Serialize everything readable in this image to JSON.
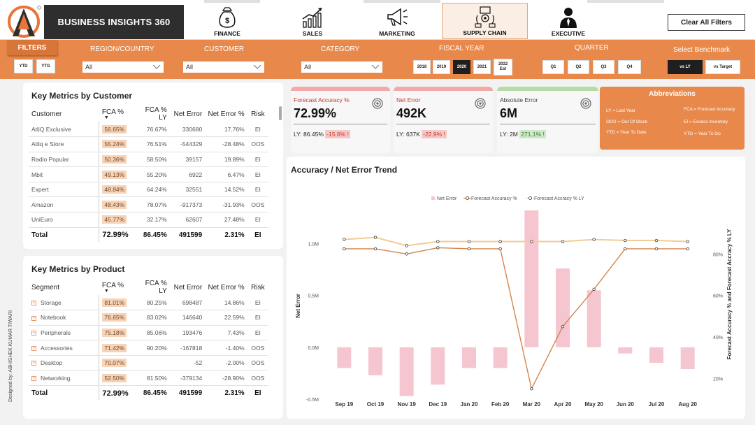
{
  "brand": {
    "title": "BUSINESS INSIGHTS 360"
  },
  "nav": {
    "tabs": [
      {
        "label": "FINANCE",
        "icon": "money-bag-icon"
      },
      {
        "label": "SALES",
        "icon": "sales-growth-icon"
      },
      {
        "label": "MARKETING",
        "icon": "megaphone-icon"
      },
      {
        "label": "SUPPLY CHAIN",
        "icon": "supply-chain-icon",
        "active": true
      },
      {
        "label": "EXECUTIVE",
        "icon": "executive-icon"
      }
    ],
    "clear_filters": "Clear All Filters"
  },
  "filters": {
    "tab_label": "FILTERS",
    "ytd": "YTD",
    "ytg": "YTG",
    "region_label": "REGION/COUNTRY",
    "customer_label": "CUSTOMER",
    "category_label": "CATEGORY",
    "fiscal_year_label": "FISCAL YEAR",
    "quarter_label": "QUARTER",
    "benchmark_label": "Select Benchmark",
    "region_value": "All",
    "customer_value": "All",
    "category_value": "All",
    "years": [
      "2018",
      "2019",
      "2020",
      "2021",
      "2022 Est"
    ],
    "selected_year": "2020",
    "quarters": [
      "Q1",
      "Q2",
      "Q3",
      "Q4"
    ],
    "benchmarks": [
      "vs LY",
      "vs Target"
    ],
    "selected_benchmark": "vs LY"
  },
  "customer_table": {
    "title": "Key Metrics by Customer",
    "headers": [
      "Customer",
      "FCA %",
      "FCA % LY",
      "Net Error",
      "Net Error %",
      "Risk"
    ],
    "rows": [
      [
        "AtliQ Exclusive",
        "56.65%",
        "76.67%",
        "330680",
        "17.76%",
        "EI"
      ],
      [
        "Atliq e Store",
        "55.24%",
        "76.51%",
        "-544329",
        "-28.48%",
        "OOS"
      ],
      [
        "Radio Popular",
        "50.36%",
        "58.50%",
        "39157",
        "19.89%",
        "EI"
      ],
      [
        "Mbit",
        "49.13%",
        "55.20%",
        "6922",
        "6.47%",
        "EI"
      ],
      [
        "Expert",
        "48.84%",
        "64.24%",
        "32551",
        "14.52%",
        "EI"
      ],
      [
        "Amazon",
        "48.43%",
        "78.07%",
        "-917373",
        "-31.93%",
        "OOS"
      ],
      [
        "UniEuro",
        "45.77%",
        "32.17%",
        "62607",
        "27.48%",
        "EI"
      ]
    ],
    "total": [
      "Total",
      "72.99%",
      "86.45%",
      "491599",
      "2.31%",
      "EI"
    ]
  },
  "product_table": {
    "title": "Key Metrics by Product",
    "headers": [
      "Segment",
      "FCA %",
      "FCA % LY",
      "Net Error",
      "Net Error %",
      "Risk"
    ],
    "rows": [
      [
        "Storage",
        "81.01%",
        "80.25%",
        "698487",
        "14.86%",
        "EI"
      ],
      [
        "Notebook",
        "76.65%",
        "83.02%",
        "146640",
        "22.59%",
        "EI"
      ],
      [
        "Peripherals",
        "75.18%",
        "85.06%",
        "193476",
        "7.43%",
        "EI"
      ],
      [
        "Accessories",
        "71.42%",
        "90.20%",
        "-167818",
        "-1.40%",
        "OOS"
      ],
      [
        "Desktop",
        "70.07%",
        "",
        "-52",
        "-2.00%",
        "OOS"
      ],
      [
        "Networking",
        "52.50%",
        "81.50%",
        "-379134",
        "-28.90%",
        "OOS"
      ]
    ],
    "total": [
      "Total",
      "72.99%",
      "86.45%",
      "491599",
      "2.31%",
      "EI"
    ]
  },
  "kpis": [
    {
      "label": "Forecast Accuracy %",
      "value": "72.99%",
      "ly_label": "LY:",
      "ly_value": "86.45%",
      "change": "-15.6%",
      "change_icon": "!",
      "trend": "neg",
      "top_color": "#f4a9a9"
    },
    {
      "label": "Net Error",
      "value": "492K",
      "ly_label": "LY:",
      "ly_value": "637K",
      "change": "-22.9%",
      "change_icon": "!",
      "trend": "neg",
      "top_color": "#f4a9a9"
    },
    {
      "label": "Absolute Error",
      "value": "6M",
      "ly_label": "LY:",
      "ly_value": "2M",
      "change": "271.1%",
      "change_icon": "!",
      "trend": "pos",
      "top_color": "#b5dca8"
    }
  ],
  "abbreviations": {
    "title": "Abbreviations",
    "items": [
      "LY = Last Year",
      "FCA = Forecast Accuracy",
      "OOS = Out Of Stock",
      "EI = Excess Inventory",
      "YTD = Year To Date",
      "YTG = Year To Go"
    ]
  },
  "credit": "Designed by: ABHISHEK KUMAR TIWARI",
  "chart_data": {
    "type": "bar",
    "title": "Accuracy / Net Error Trend",
    "categories": [
      "Sep 19",
      "Oct 19",
      "Nov 19",
      "Dec 19",
      "Jan 20",
      "Feb 20",
      "Mar 20",
      "Apr 20",
      "May 20",
      "Jun 20",
      "Jul 20",
      "Aug 20"
    ],
    "ylabel": "Net Error",
    "y2label": "Forecast Accuracy % and Forecast Accracy % LY",
    "ylim": [
      -0.5,
      1.3
    ],
    "y2lim": [
      0.1,
      1.0
    ],
    "yticks": [
      "1.0M",
      "0.5M",
      "0.0M",
      "-0.5M"
    ],
    "y2ticks": [
      "80%",
      "60%",
      "40%",
      "20%"
    ],
    "legend": [
      "Net Error",
      "Forecast Accuracy %",
      "Forecast Accracy % LY"
    ],
    "legend_position": "top-center",
    "series": [
      {
        "name": "Net Error",
        "kind": "bar",
        "color": "#f5c6d0",
        "values": [
          -0.2,
          -0.27,
          -0.47,
          -0.36,
          -0.2,
          -0.2,
          1.32,
          0.76,
          0.55,
          -0.06,
          -0.15,
          -0.21
        ]
      },
      {
        "name": "Forecast Accuracy %",
        "kind": "line",
        "axis": "y2",
        "color": "#d4854c",
        "values": [
          0.825,
          0.825,
          0.8,
          0.83,
          0.825,
          0.825,
          0.15,
          0.45,
          0.63,
          0.825,
          0.825,
          0.825
        ]
      },
      {
        "name": "Forecast Accracy % LY",
        "kind": "line",
        "axis": "y2",
        "color": "#f1cc96",
        "values": [
          0.87,
          0.88,
          0.84,
          0.86,
          0.86,
          0.86,
          0.86,
          0.86,
          0.87,
          0.865,
          0.865,
          0.86
        ]
      }
    ]
  }
}
